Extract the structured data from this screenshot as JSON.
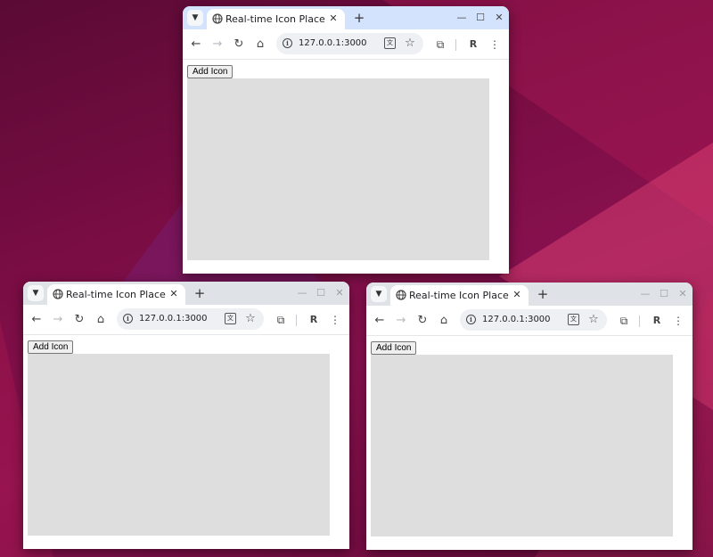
{
  "windows": [
    {
      "id": "window-top",
      "focused": true,
      "tab": {
        "title": "Real-time Icon Placement",
        "globe_icon": "globe-icon",
        "close_label": "✕"
      },
      "new_tab_label": "+",
      "controls": {
        "minimize": "—",
        "maximize": "☐",
        "close": "✕"
      },
      "toolbar": {
        "back": "←",
        "forward": "→",
        "reload": "↻",
        "home": "⌂",
        "url": "127.0.0.1:3000",
        "translate": "文",
        "bookmark": "☆",
        "extensions": "⧉",
        "profile": "R",
        "menu": "⋮"
      },
      "page": {
        "button_label": "Add Icon"
      }
    },
    {
      "id": "window-bottom-left",
      "focused": false,
      "tab": {
        "title": "Real-time Icon Placement",
        "globe_icon": "globe-icon",
        "close_label": "✕"
      },
      "new_tab_label": "+",
      "controls": {
        "minimize": "—",
        "maximize": "☐",
        "close": "✕"
      },
      "toolbar": {
        "back": "←",
        "forward": "→",
        "reload": "↻",
        "home": "⌂",
        "url": "127.0.0.1:3000",
        "translate": "文",
        "bookmark": "☆",
        "extensions": "⧉",
        "profile": "R",
        "menu": "⋮"
      },
      "page": {
        "button_label": "Add Icon"
      }
    },
    {
      "id": "window-bottom-right",
      "focused": false,
      "tab": {
        "title": "Real-time Icon Placement",
        "globe_icon": "globe-icon",
        "close_label": "✕"
      },
      "new_tab_label": "+",
      "controls": {
        "minimize": "—",
        "maximize": "☐",
        "close": "✕"
      },
      "toolbar": {
        "back": "←",
        "forward": "→",
        "reload": "↻",
        "home": "⌂",
        "url": "127.0.0.1:3000",
        "translate": "文",
        "bookmark": "☆",
        "extensions": "⧉",
        "profile": "R",
        "menu": "⋮"
      },
      "page": {
        "button_label": "Add Icon"
      }
    }
  ],
  "colors": {
    "desktop_background": "#7a0d44",
    "focused_titlebar": "#d3e3fd",
    "unfocused_titlebar": "#dfe3e7",
    "canvas_gray": "#dedede"
  }
}
